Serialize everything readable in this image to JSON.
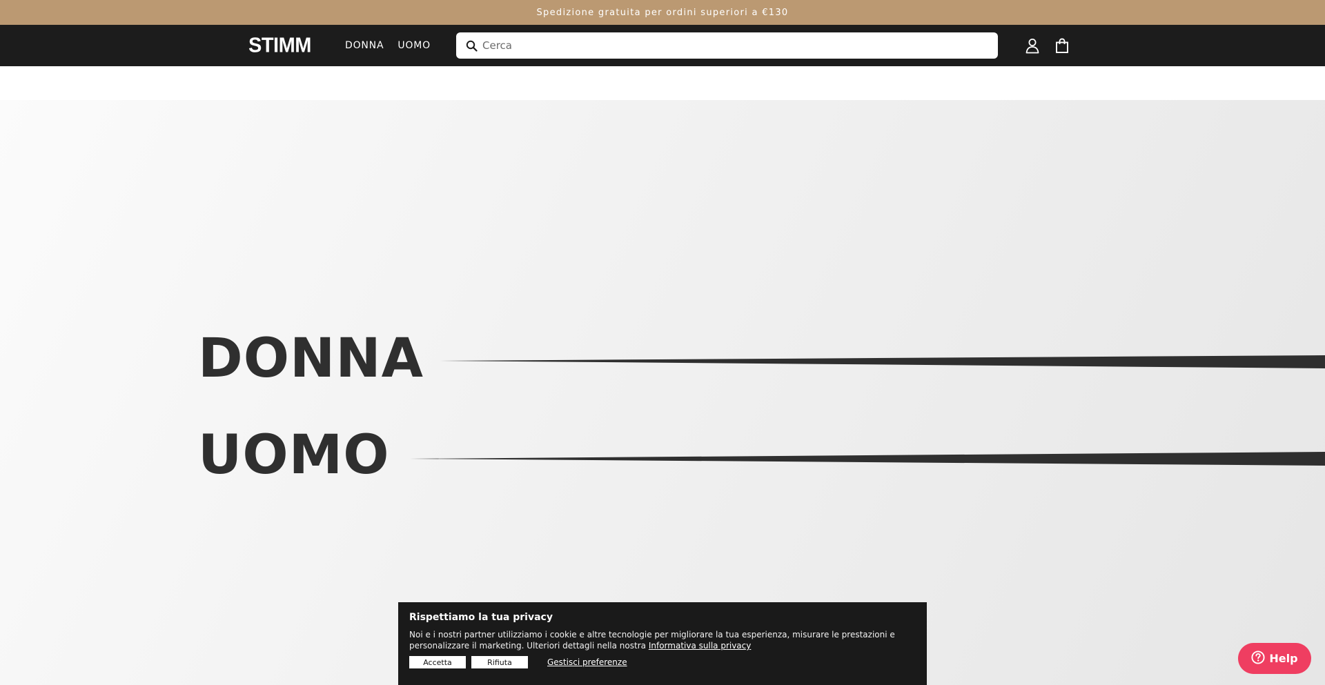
{
  "announcement": {
    "text": "Spedizione gratuita per ordini superiori a €130"
  },
  "header": {
    "logo": "STIMM",
    "nav": [
      {
        "label": "DONNA"
      },
      {
        "label": "UOMO"
      }
    ],
    "search": {
      "placeholder": "Cerca",
      "value": ""
    },
    "icons": [
      "search-icon",
      "account-icon",
      "bag-icon"
    ]
  },
  "hero": {
    "links": [
      {
        "label": "DONNA"
      },
      {
        "label": "UOMO"
      }
    ]
  },
  "cookie_banner": {
    "title": "Rispettiamo la tua privacy",
    "text": "Noi e i nostri partner utilizziamo i cookie e altre tecnologie per migliorare la tua esperienza, misurare le prestazioni e personalizzare il marketing. Ulteriori dettagli nella nostra",
    "policy_link": "Informativa sulla privacy",
    "accept_label": "Accetta",
    "reject_label": "Rifiuta",
    "manage_label": "Gestisci preferenze"
  },
  "help_button": {
    "label": "Help"
  },
  "colors": {
    "announcement_bg": "#bb9972",
    "header_bg": "#1c1c1c",
    "hero_text": "#2f2f2f",
    "help_bg": "#ef3e61"
  }
}
